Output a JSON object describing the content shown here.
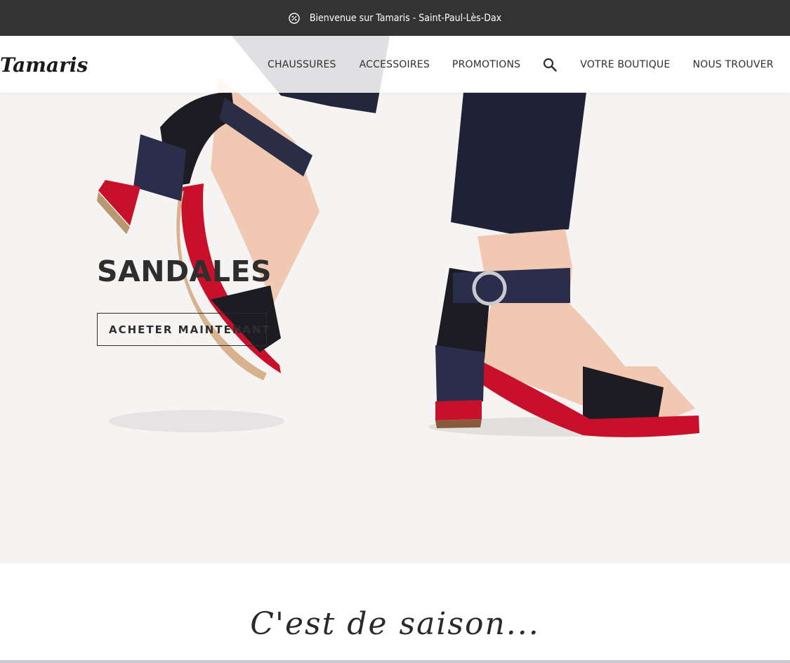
{
  "topbar": {
    "icon": "discount-badge-icon",
    "message": "Bienvenue sur Tamaris - Saint-Paul-Lès-Dax"
  },
  "brand": {
    "logo_text": "Tamaris"
  },
  "nav": {
    "items": [
      {
        "label": "CHAUSSURES"
      },
      {
        "label": "ACCESSOIRES"
      },
      {
        "label": "PROMOTIONS"
      },
      {
        "label": "VOTRE BOUTIQUE"
      },
      {
        "label": "NOUS TROUVER"
      }
    ],
    "search_icon": "search-icon"
  },
  "hero": {
    "title": "SANDALES",
    "cta_label": "ACHETER MAINTENANT",
    "image": "model-wearing-block-heel-sandals-photo"
  },
  "section": {
    "title": "C'est de saison..."
  },
  "colors": {
    "topbar_bg": "#333333",
    "hero_bg": "#f5f4f3",
    "text": "#2e2e2e",
    "accent_red": "#c8102e",
    "navy": "#1f2236"
  }
}
